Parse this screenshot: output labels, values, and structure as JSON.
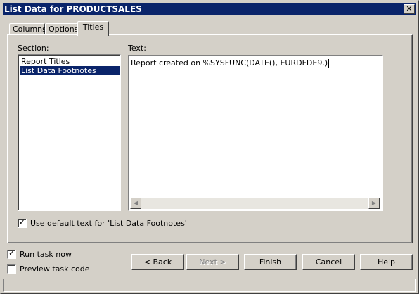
{
  "window": {
    "title": "List Data for PRODUCTSALES",
    "close_glyph": "✕"
  },
  "tabs": [
    {
      "label": "Columns",
      "active": false
    },
    {
      "label": "Options",
      "active": false
    },
    {
      "label": "Titles",
      "active": true
    }
  ],
  "titles_panel": {
    "section_label": "Section:",
    "sections": [
      {
        "label": "Report Titles",
        "selected": false
      },
      {
        "label": "List Data Footnotes",
        "selected": true
      }
    ],
    "text_label": "Text:",
    "text_value": "Report created on %SYSFUNC(DATE(), EURDFDE9.)",
    "use_default_label": "Use default text for 'List Data Footnotes'",
    "use_default_checked": true
  },
  "footer": {
    "run_task_label": "Run task now",
    "run_task_checked": true,
    "preview_label": "Preview task code",
    "preview_checked": false,
    "buttons": {
      "back": "< Back",
      "next": "Next >",
      "finish": "Finish",
      "cancel": "Cancel",
      "help": "Help"
    }
  },
  "colors": {
    "titlebar": "#0a246a",
    "face": "#d4d0c8",
    "selection": "#0a246a"
  }
}
